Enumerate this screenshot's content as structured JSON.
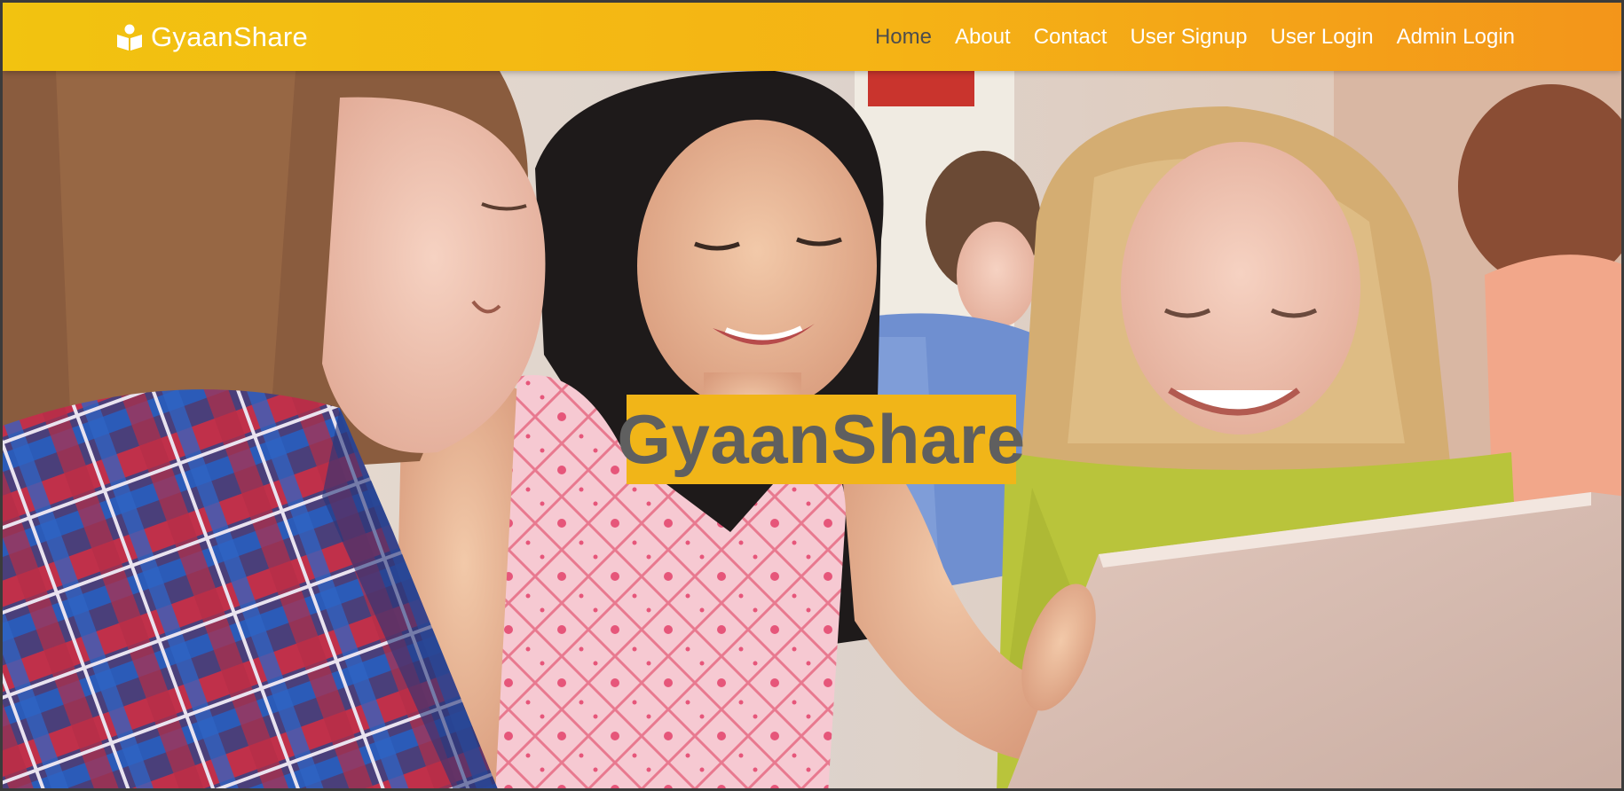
{
  "brand": {
    "name": "GyaanShare",
    "icon": "reader-book-icon"
  },
  "nav": {
    "items": [
      {
        "label": "Home",
        "active": true
      },
      {
        "label": "About",
        "active": false
      },
      {
        "label": "Contact",
        "active": false
      },
      {
        "label": "User Signup",
        "active": false
      },
      {
        "label": "User Login",
        "active": false
      },
      {
        "label": "Admin Login",
        "active": false
      }
    ]
  },
  "hero": {
    "title": "GyaanShare",
    "image": "children-using-laptop-photo"
  },
  "colors": {
    "navbar_start": "#f2c310",
    "navbar_end": "#f3951a",
    "accent": "#f1b518",
    "active_link": "#4d4d4d",
    "hero_title_text": "#5f5f5f"
  }
}
